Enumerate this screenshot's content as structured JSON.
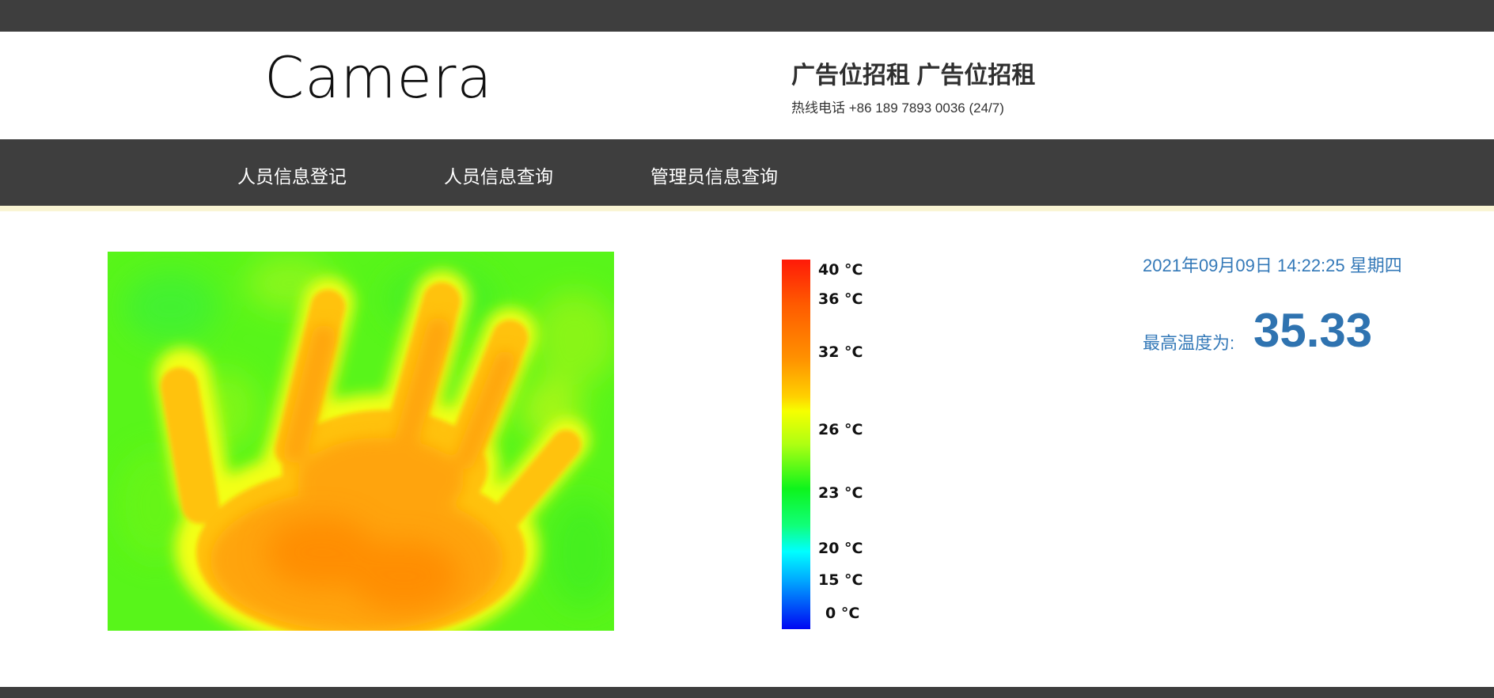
{
  "header": {
    "logo": "Camera",
    "ad_title": "广告位招租 广告位招租",
    "hotline": "热线电话 +86 189 7893 0036 (24/7)"
  },
  "nav": {
    "items": [
      {
        "label": "人员信息登记"
      },
      {
        "label": "人员信息查询"
      },
      {
        "label": "管理员信息查询"
      }
    ]
  },
  "colorbar": {
    "ticks": [
      "40 °C",
      "36 °C",
      "32 °C",
      "26 °C",
      "23 °C",
      "20 °C",
      "15 °C",
      "0 °C"
    ]
  },
  "info": {
    "datetime": "2021年09月09日 14:22:25 星期四",
    "max_label": "最高温度为:",
    "max_value": "35.33"
  },
  "colors": {
    "dark_bar": "#3e3e3e",
    "accent_blue": "#3479b8",
    "nav_accent": "#faf5d4"
  }
}
